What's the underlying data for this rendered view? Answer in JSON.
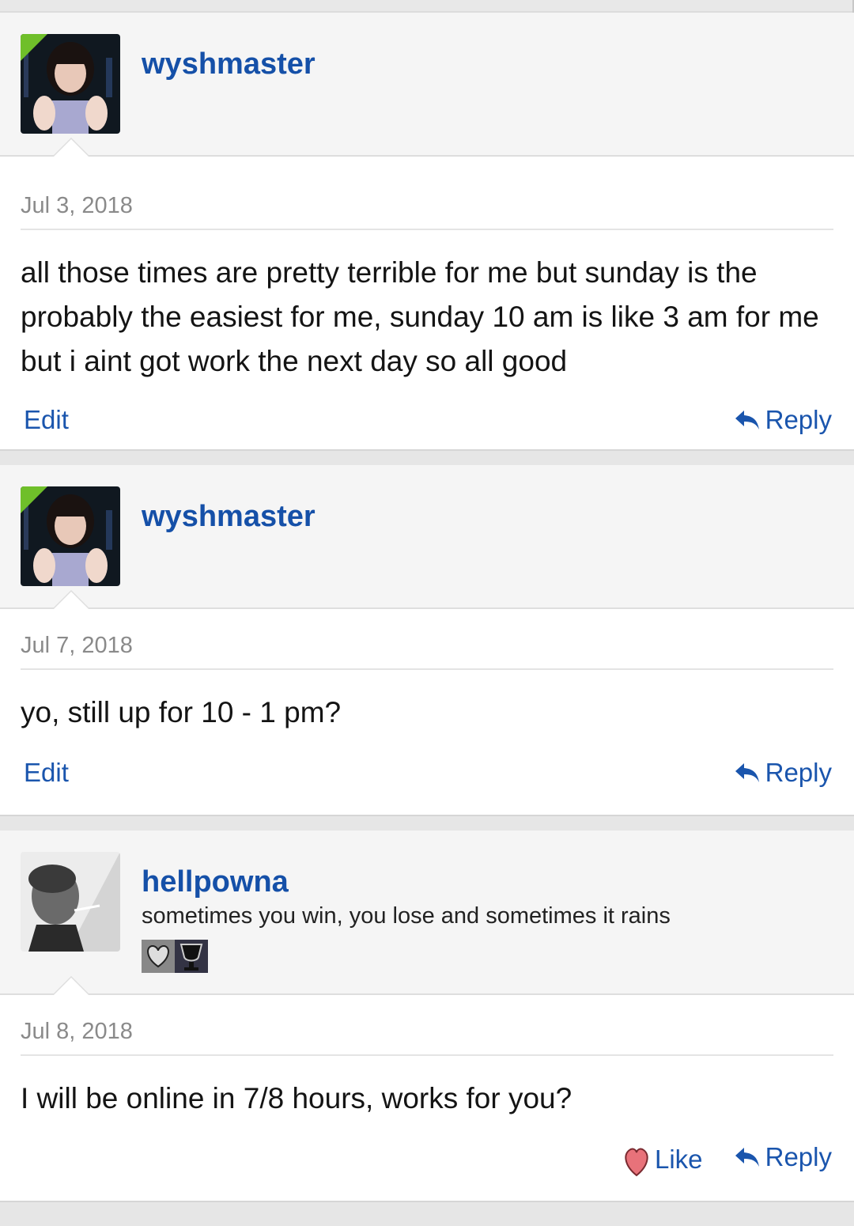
{
  "posts": [
    {
      "username": "wyshmaster",
      "date": "Jul 3, 2018",
      "message": "all those times are pretty terrible for me but sunday is the probably the easiest for me, sunday 10 am is like 3 am for me but i aint got work the next day so all good",
      "edit_label": "Edit",
      "reply_label": "Reply"
    },
    {
      "username": "wyshmaster",
      "date": "Jul 7, 2018",
      "message": "yo, still up for 10 - 1 pm?",
      "edit_label": "Edit",
      "reply_label": "Reply"
    },
    {
      "username": "hellpowna",
      "user_title": "sometimes you win, you lose and sometimes it rains",
      "date": "Jul 8, 2018",
      "message": "I will be online in 7/8 hours, works for you?",
      "like_label": "Like",
      "reply_label": "Reply"
    }
  ],
  "colors": {
    "link": "#1a55ad",
    "username": "#1550a8",
    "online_badge": "#6fbf2a"
  }
}
